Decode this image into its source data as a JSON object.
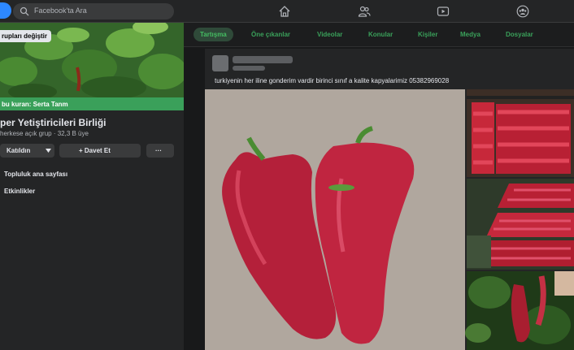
{
  "search": {
    "placeholder": "Facebook'ta Ara"
  },
  "nav": [
    "home-icon",
    "friends-icon",
    "watch-icon",
    "groups-icon"
  ],
  "left_panel": {
    "cover_badge": "rupları değiştir",
    "creator": "bu kuran: Serta Tanm",
    "group_name": "per Yetiştiricileri Birliği",
    "group_meta": "herkese açık grup · 32,3 B üye",
    "joined_button": "Katıldın",
    "invite_button": "+ Davet Et",
    "more_button": "···",
    "links": [
      "Topluluk ana sayfası",
      "Etkinlikler"
    ]
  },
  "tabs": [
    "Tartışma",
    "Öne çıkanlar",
    "Videolar",
    "Konular",
    "Kişiler",
    "Medya",
    "Dosyalar"
  ],
  "post": {
    "text": "turkiyenin her iline gonderim vardir birinci sınıf a kalite kapyalarimiz 05382969028"
  },
  "colors": {
    "accent": "#45bd62",
    "bg": "#18191a",
    "card": "#242526"
  }
}
